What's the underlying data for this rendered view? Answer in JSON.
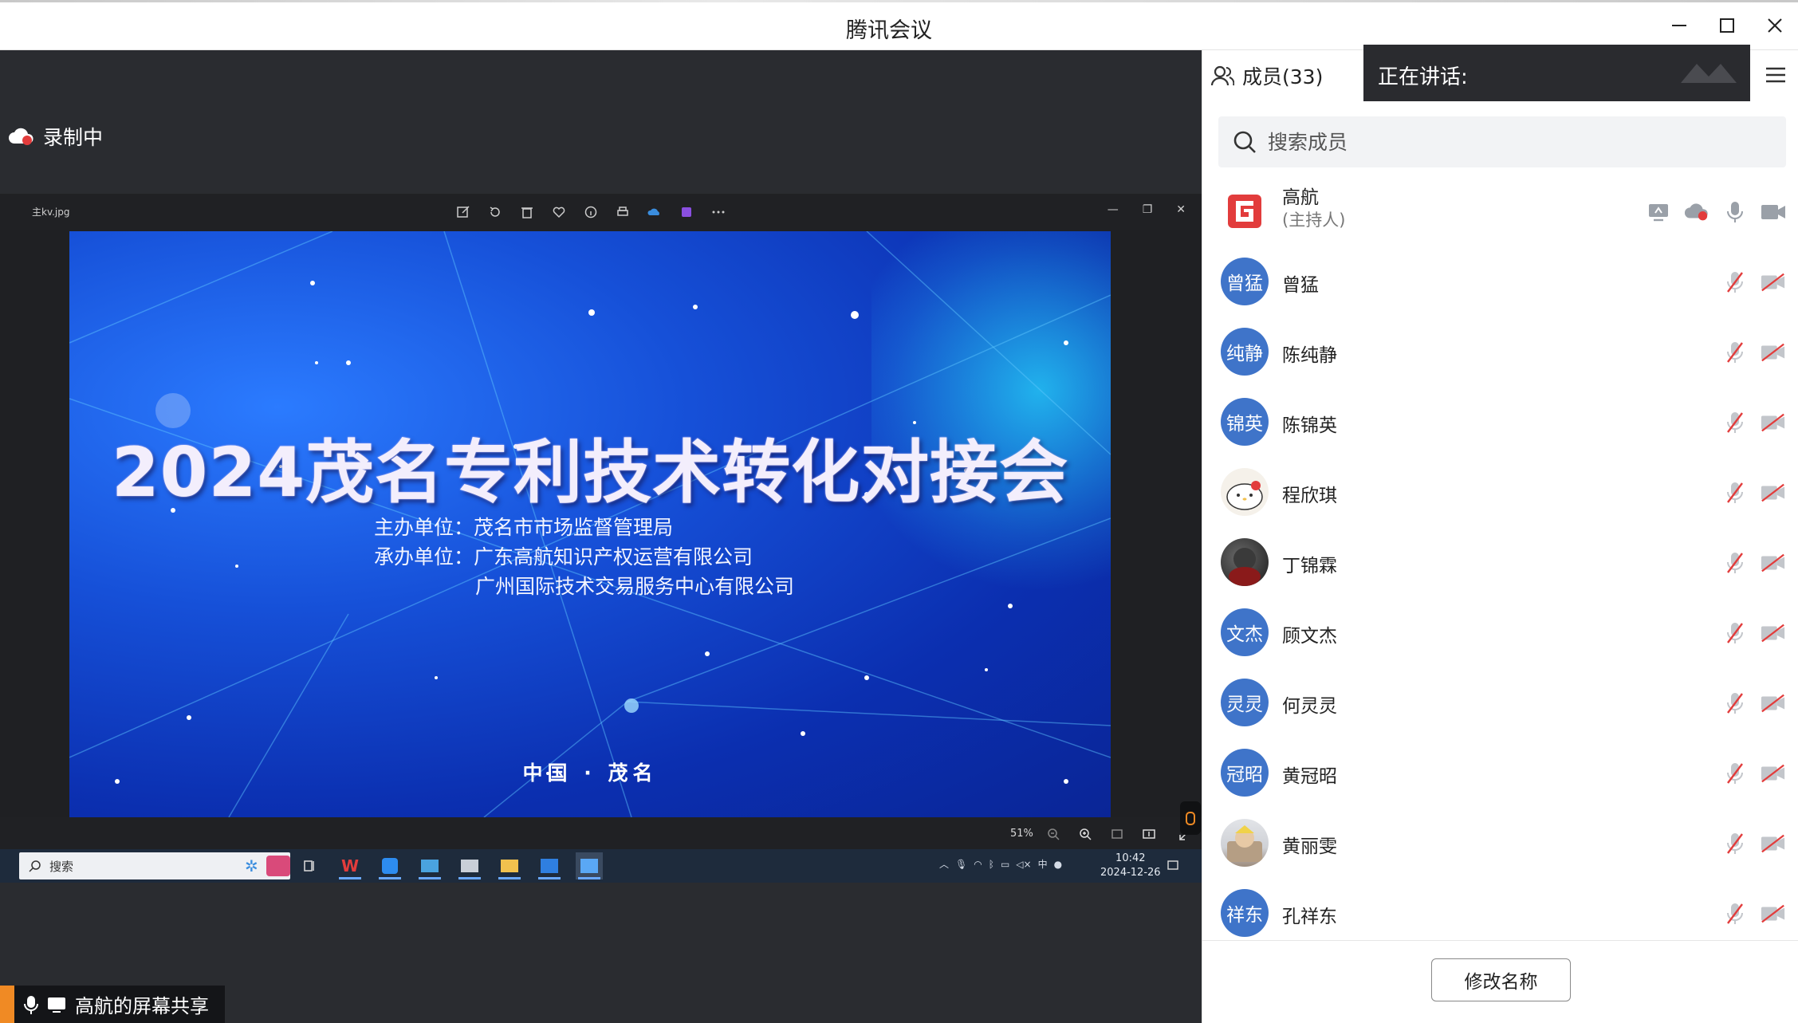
{
  "window": {
    "title": "腾讯会议"
  },
  "recording": {
    "label": "录制中"
  },
  "viewer": {
    "filename": "主kv.jpg",
    "zoom": "51%"
  },
  "slide": {
    "title": "2024茂名专利技术转化对接会",
    "organizer_line": "主办单位：茂名市市场监督管理局",
    "coorganizer_line": "承办单位：广东高航知识产权运营有限公司",
    "coorganizer_line2": "广州国际技术交易服务中心有限公司",
    "location": "中国 · 茂名"
  },
  "taskbar": {
    "search_label": "搜索",
    "time": "10:42",
    "date": "2024-12-26",
    "ime": "中"
  },
  "share_status": {
    "label": "高航的屏幕共享"
  },
  "panel": {
    "members_tab_label": "成员(33)",
    "speaking_label": "正在讲话:",
    "search_placeholder": "搜索成员",
    "rename_button": "修改名称"
  },
  "members": [
    {
      "name": "高航",
      "role": "(主持人)",
      "avatar": "",
      "kind": "host"
    },
    {
      "name": "曾猛",
      "avatar": "曾猛",
      "kind": "initials"
    },
    {
      "name": "陈纯静",
      "avatar": "纯静",
      "kind": "initials"
    },
    {
      "name": "陈锦英",
      "avatar": "锦英",
      "kind": "initials"
    },
    {
      "name": "程欣琪",
      "avatar": "",
      "kind": "cat"
    },
    {
      "name": "丁锦霖",
      "avatar": "",
      "kind": "dark"
    },
    {
      "name": "顾文杰",
      "avatar": "文杰",
      "kind": "initials"
    },
    {
      "name": "何灵灵",
      "avatar": "灵灵",
      "kind": "initials"
    },
    {
      "name": "黄冠昭",
      "avatar": "冠昭",
      "kind": "initials"
    },
    {
      "name": "黄丽雯",
      "avatar": "",
      "kind": "photo"
    },
    {
      "name": "孔祥东",
      "avatar": "祥东",
      "kind": "initials"
    }
  ],
  "colors": {
    "avatar_blue": "#3f74c9",
    "muted_red": "#e23c3c",
    "accent_orange": "#f08a24"
  }
}
